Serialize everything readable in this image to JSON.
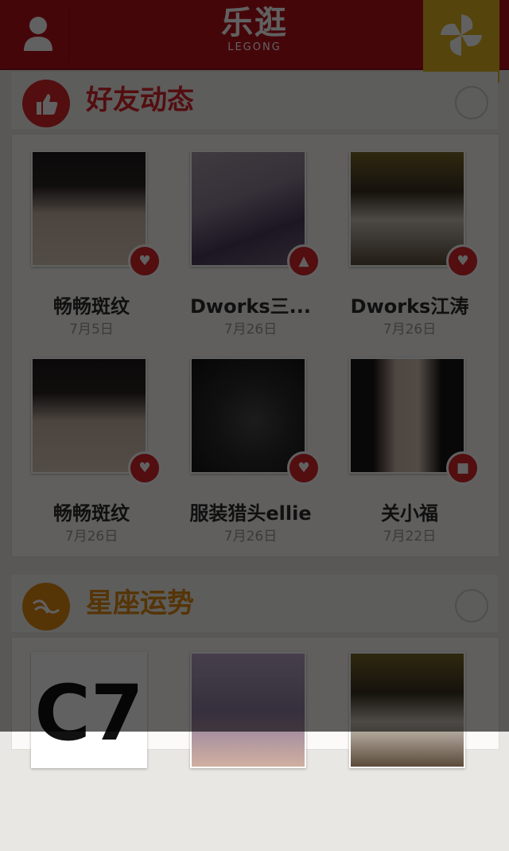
{
  "header": {
    "title": "乐逛",
    "subtitle": "LEGONG",
    "user_icon": "user-icon",
    "menu_icon": "pinwheel-icon",
    "bar_color": "#b5121b",
    "ribbon_color": "#e0b21e"
  },
  "friends_section": {
    "title": "好友动态",
    "icon": "thumbs-up-icon",
    "accent": "#d9252b",
    "items": [
      {
        "name": "畅畅斑纹",
        "time": "7月5日",
        "badge_icon": "heart-icon"
      },
      {
        "name": "Dworks三...",
        "time": "7月26日",
        "badge_icon": "thumbs-up-icon"
      },
      {
        "name": "Dworks江涛",
        "time": "7月26日",
        "badge_icon": "heart-icon"
      },
      {
        "name": "畅畅斑纹",
        "time": "7月26日",
        "badge_icon": "heart-icon"
      },
      {
        "name": "服装猎头ellie",
        "time": "7月26日",
        "badge_icon": "heart-icon"
      },
      {
        "name": "关小福",
        "time": "7月22日",
        "badge_icon": "truck-icon"
      }
    ]
  },
  "horoscope_section": {
    "title": "星座运势",
    "icon": "constellation-icon",
    "accent": "#e08a12",
    "items": [
      {
        "label": "C7",
        "photo": "logo"
      },
      {
        "photo": "photo"
      },
      {
        "photo": "photo"
      }
    ]
  }
}
